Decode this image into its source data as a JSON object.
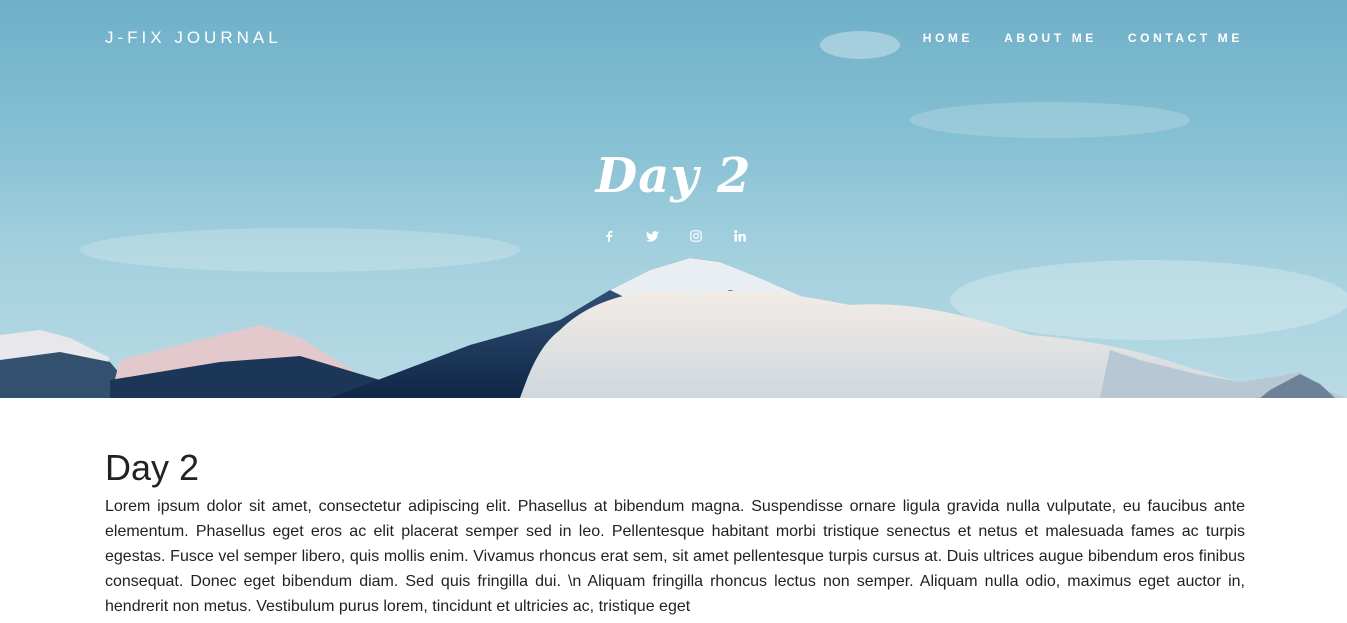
{
  "nav": {
    "brand": "J-FIX JOURNAL",
    "links": [
      "HOME",
      "ABOUT ME",
      "CONTACT ME"
    ]
  },
  "hero": {
    "title": "Day 2",
    "social_icons": [
      "facebook-icon",
      "twitter-icon",
      "instagram-icon",
      "linkedin-icon"
    ]
  },
  "post": {
    "title": "Day 2",
    "body": "Lorem ipsum dolor sit amet, consectetur adipiscing elit. Phasellus at bibendum magna. Suspendisse ornare ligula gravida nulla vulputate, eu faucibus ante elementum. Phasellus eget eros ac elit placerat semper sed in leo. Pellentesque habitant morbi tristique senectus et netus et malesuada fames ac turpis egestas. Fusce vel semper libero, quis mollis enim. Vivamus rhoncus erat sem, sit amet pellentesque turpis cursus at. Duis ultrices augue bibendum eros finibus consequat. Donec eget bibendum diam. Sed quis fringilla dui. \\n Aliquam fringilla rhoncus lectus non semper. Aliquam nulla odio, maximus eget auctor in, hendrerit non metus. Vestibulum purus lorem, tincidunt et ultricies ac, tristique eget"
  },
  "colors": {
    "sky": "#86c0d3",
    "mountain": "#1f3f66",
    "text": "#222222"
  }
}
